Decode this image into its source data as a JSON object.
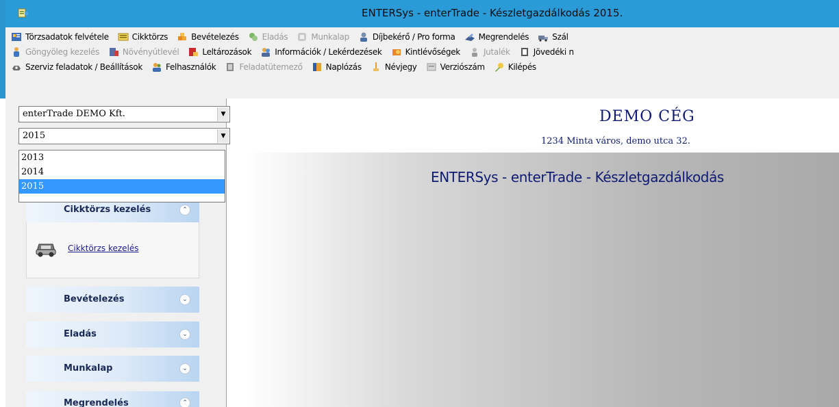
{
  "window": {
    "title": "ENTERSys - enterTrade - Készletgazdálkodás 2015."
  },
  "toolbar": {
    "row1": [
      {
        "label": "Törzsadatok felvétele",
        "icon": "records-icon",
        "disabled": false
      },
      {
        "label": "Cikktörzs",
        "icon": "item-register-icon",
        "disabled": false
      },
      {
        "label": "Bevételezés",
        "icon": "receiving-icon",
        "disabled": false
      },
      {
        "label": "Eladás",
        "icon": "sales-icon",
        "disabled": true
      },
      {
        "label": "Munkalap",
        "icon": "worksheet-icon",
        "disabled": true
      },
      {
        "label": "Díjbekérő / Pro forma",
        "icon": "proforma-icon",
        "disabled": false
      },
      {
        "label": "Megrendelés",
        "icon": "order-icon",
        "disabled": false
      },
      {
        "label": "Szál",
        "icon": "delivery-icon",
        "disabled": false
      }
    ],
    "row2": [
      {
        "label": "Göngyöleg kezelés",
        "icon": "packaging-icon",
        "disabled": true
      },
      {
        "label": "Növényútlevél",
        "icon": "plant-passport-icon",
        "disabled": true
      },
      {
        "label": "Leltározások",
        "icon": "inventory-icon",
        "disabled": false
      },
      {
        "label": "Információk / Lekérdezések",
        "icon": "info-query-icon",
        "disabled": false
      },
      {
        "label": "Kintlévőségek",
        "icon": "receivables-icon",
        "disabled": false
      },
      {
        "label": "Jutalék",
        "icon": "commission-icon",
        "disabled": true
      },
      {
        "label": "Jövedéki n",
        "icon": "excise-icon",
        "disabled": false
      }
    ],
    "row3": [
      {
        "label": "Szerviz feladatok / Beállítások",
        "icon": "service-settings-icon",
        "disabled": false
      },
      {
        "label": "Felhasználók",
        "icon": "users-icon",
        "disabled": false
      },
      {
        "label": "Feladatütemező",
        "icon": "scheduler-icon",
        "disabled": true
      },
      {
        "label": "Naplózás",
        "icon": "logging-icon",
        "disabled": false
      },
      {
        "label": "Névjegy",
        "icon": "about-icon",
        "disabled": false
      },
      {
        "label": "Verziószám",
        "icon": "version-icon",
        "disabled": false
      },
      {
        "label": "Kilépés",
        "icon": "exit-icon",
        "disabled": false
      }
    ]
  },
  "sidebar": {
    "company_select": {
      "value": "enterTrade DEMO Kft."
    },
    "year_select": {
      "value": "2015",
      "options": [
        "2013",
        "2014",
        "2015"
      ],
      "selected_index": 2
    },
    "panels": [
      {
        "label": "Cikktörzs kezelés",
        "expanded": true,
        "items": [
          {
            "label": "Cikktörzs kezelés",
            "icon": "car-icon"
          }
        ]
      },
      {
        "label": "Bevételezés",
        "expanded": false
      },
      {
        "label": "Eladás",
        "expanded": false
      },
      {
        "label": "Munkalap",
        "expanded": false
      },
      {
        "label": "Megrendelés",
        "expanded": true
      }
    ]
  },
  "main": {
    "company_name": "DEMO CÉG",
    "company_address": "1234 Minta város, demo utca 32.",
    "app_title": "ENTERSys - enterTrade - Készletgazdálkodás"
  },
  "colors": {
    "titlebar": "#2b9bd8",
    "dropdown_selected": "#3399ff",
    "heading_text": "#0e1a73"
  }
}
